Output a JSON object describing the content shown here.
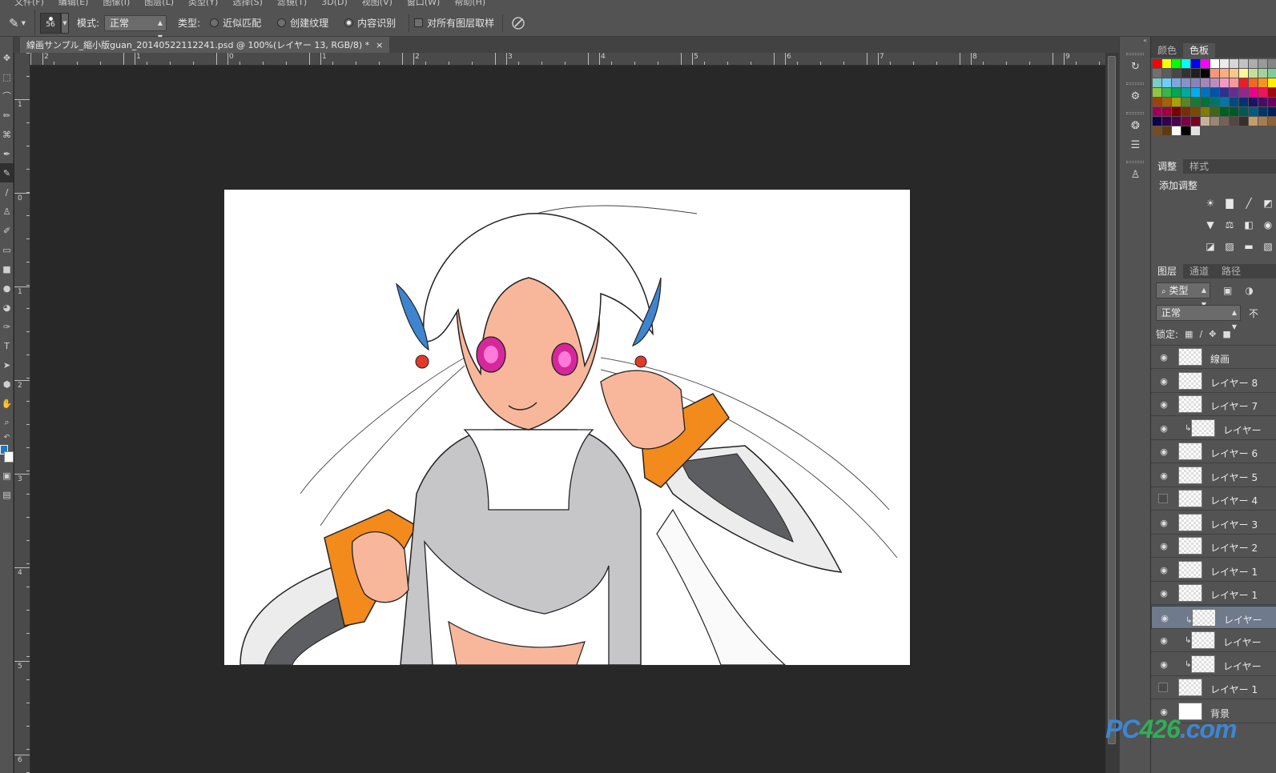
{
  "menubar": {
    "items": [
      "文件(F)",
      "编辑(E)",
      "图像(I)",
      "图层(L)",
      "类型(Y)",
      "选择(S)",
      "滤镜(T)",
      "3D(D)",
      "视图(V)",
      "窗口(W)",
      "帮助(H)"
    ]
  },
  "options": {
    "brush_size": "56",
    "mode_label": "模式:",
    "mode_value": "正常",
    "type_label": "类型:",
    "type_options": [
      {
        "label": "近似匹配",
        "selected": false
      },
      {
        "label": "创建纹理",
        "selected": false
      },
      {
        "label": "内容识别",
        "selected": true
      }
    ],
    "sample_all_label": "对所有图层取样",
    "sample_all_checked": false
  },
  "document": {
    "tab_title": "線画サンプル_縮小版guan_20140522112241.psd @ 100%(レイヤー 13, RGB/8) *",
    "close_symbol": "×"
  },
  "rulers": {
    "h_labels": [
      "2",
      "1",
      "0",
      "1",
      "2",
      "3",
      "4",
      "5",
      "6",
      "7",
      "8",
      "9"
    ],
    "v_labels": [
      "1",
      "0",
      "1",
      "2",
      "3",
      "4",
      "5",
      "6"
    ]
  },
  "swatches_panel": {
    "tabs": [
      {
        "label": "颜色",
        "active": false
      },
      {
        "label": "色板",
        "active": true
      }
    ],
    "colors": [
      "#ff0000",
      "#ffff00",
      "#00ff00",
      "#00ffff",
      "#0000ff",
      "#ff00ff",
      "#ffffff",
      "#ebebeb",
      "#d6d6d6",
      "#c2c2c2",
      "#adadad",
      "#999999",
      "#858585",
      "#707070",
      "#5c5c5c",
      "#474747",
      "#333333",
      "#1f1f1f",
      "#000000",
      "#f7977a",
      "#f9ad81",
      "#fdc68a",
      "#fff79a",
      "#c4df9b",
      "#a3d39c",
      "#82ca9d",
      "#7bcdc8",
      "#6ecff6",
      "#7ea7d8",
      "#8493ca",
      "#8882be",
      "#a187be",
      "#bc8dbf",
      "#f49ac2",
      "#f6989d",
      "#ed1c24",
      "#f26522",
      "#f7941d",
      "#fff200",
      "#8dc63f",
      "#39b54a",
      "#00a651",
      "#00a99d",
      "#00aeef",
      "#0072bc",
      "#0054a6",
      "#2e3192",
      "#662d91",
      "#92278f",
      "#ec008c",
      "#ed145b",
      "#9e0b0f",
      "#a0410d",
      "#a36209",
      "#aba000",
      "#598527",
      "#197b30",
      "#007236",
      "#00746b",
      "#0076a3",
      "#004b80",
      "#003471",
      "#1b1464",
      "#440e62",
      "#630460",
      "#9e005d",
      "#9e0039",
      "#790000",
      "#7b2e00",
      "#7d4900",
      "#827b00",
      "#406618",
      "#005e20",
      "#005826",
      "#005952",
      "#005b7f",
      "#003663",
      "#002157",
      "#0d004c",
      "#32004b",
      "#4b0049",
      "#7b0046",
      "#7a0026",
      "#c7b299",
      "#998675",
      "#736357",
      "#534741",
      "#37302a",
      "#c69c6d",
      "#a67c52",
      "#8c6239",
      "#754c24",
      "#603913",
      "#ffffff",
      "#000000",
      "#e1e1e1"
    ]
  },
  "adjustments_panel": {
    "tabs": [
      {
        "label": "调整",
        "active": true
      },
      {
        "label": "样式",
        "active": false
      }
    ],
    "title": "添加调整",
    "rows": [
      [
        "brightness-icon",
        "levels-icon",
        "curves-icon",
        "exposure-icon"
      ],
      [
        "vibrance-icon",
        "balance-icon",
        "bw-icon",
        "photo-filter-icon"
      ],
      [
        "invert-icon",
        "posterize-icon",
        "threshold-icon",
        "gradient-map-icon"
      ]
    ]
  },
  "layers_panel": {
    "tabs": [
      {
        "label": "图层",
        "active": true
      },
      {
        "label": "通道",
        "active": false
      },
      {
        "label": "路径",
        "active": false
      }
    ],
    "filter_label": "类型",
    "blend_mode": "正常",
    "opacity_label": "不",
    "lock_label": "锁定:",
    "layers": [
      {
        "name": "線画",
        "visible": true,
        "clipped": false,
        "selected": false
      },
      {
        "name": "レイヤー 8",
        "visible": true,
        "clipped": false,
        "selected": false
      },
      {
        "name": "レイヤー 7",
        "visible": true,
        "clipped": false,
        "selected": false
      },
      {
        "name": "レイヤー",
        "visible": true,
        "clipped": true,
        "selected": false
      },
      {
        "name": "レイヤー 6",
        "visible": true,
        "clipped": false,
        "selected": false
      },
      {
        "name": "レイヤー 5",
        "visible": true,
        "clipped": false,
        "selected": false
      },
      {
        "name": "レイヤー 4",
        "visible": false,
        "clipped": false,
        "selected": false
      },
      {
        "name": "レイヤー 3",
        "visible": true,
        "clipped": false,
        "selected": false
      },
      {
        "name": "レイヤー 2",
        "visible": true,
        "clipped": false,
        "selected": false
      },
      {
        "name": "レイヤー 1",
        "visible": true,
        "clipped": false,
        "selected": false
      },
      {
        "name": "レイヤー 1",
        "visible": true,
        "clipped": false,
        "selected": false
      },
      {
        "name": "レイヤー",
        "visible": true,
        "clipped": true,
        "selected": true
      },
      {
        "name": "レイヤー",
        "visible": true,
        "clipped": true,
        "selected": false
      },
      {
        "name": "レイヤー",
        "visible": true,
        "clipped": true,
        "selected": false
      },
      {
        "name": "レイヤー 1",
        "visible": false,
        "clipped": false,
        "selected": false
      },
      {
        "name": "背景",
        "visible": true,
        "clipped": false,
        "selected": false
      }
    ]
  },
  "watermark": {
    "part1": "PC",
    "part2": "426",
    "part3": ".com"
  }
}
